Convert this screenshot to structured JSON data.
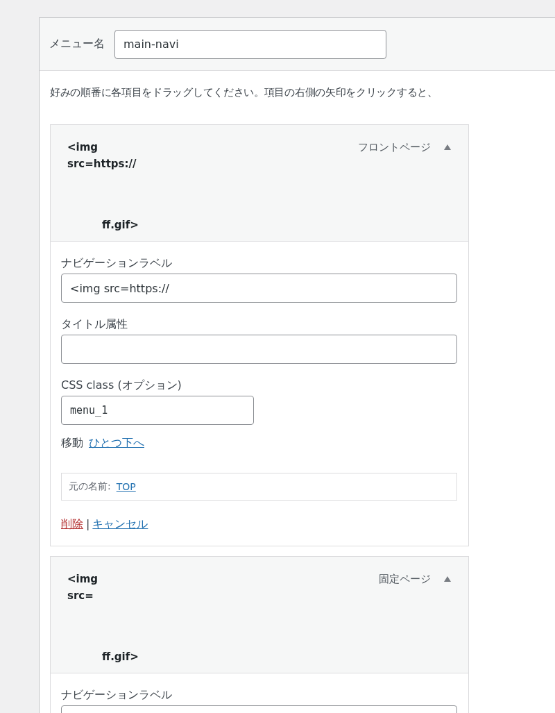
{
  "menu_name": {
    "label": "メニュー名",
    "value": "main-navi"
  },
  "instructions": "好みの順番に各項目をドラッグしてください。項目の右側の矢印をクリックすると、",
  "items": [
    {
      "title_lines": [
        "<img",
        "src=https://",
        "ff.gif>"
      ],
      "type_label": "フロントページ",
      "expanded": true,
      "fields": [
        {
          "kind": "text",
          "label": "ナビゲーションラベル",
          "value": "<img src=https://"
        },
        {
          "kind": "text",
          "label": "タイトル属性"
        },
        {
          "kind": "code",
          "label": "CSS class (オプション)",
          "value": "menu_1"
        }
      ],
      "move": {
        "label": "移動",
        "link": "ひとつ下へ"
      },
      "original": {
        "label": "元の名前:",
        "link": "TOP"
      },
      "actions": [
        {
          "kind": "delete",
          "label": "削除"
        },
        {
          "kind": "cancel",
          "label": "キャンセル"
        }
      ],
      "separator": "|"
    },
    {
      "title_lines": [
        "<img",
        "src=",
        "ff.gif>"
      ],
      "type_label": "固定ページ",
      "expanded": true,
      "fields": [
        {
          "kind": "text",
          "label": "ナビゲーションラベル"
        }
      ]
    }
  ]
}
